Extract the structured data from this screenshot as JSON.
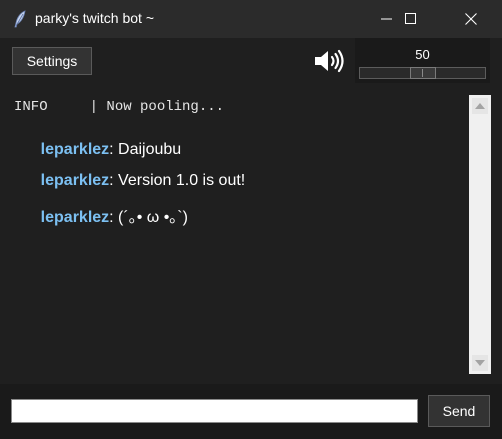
{
  "window": {
    "title": "parky's twitch bot ~"
  },
  "toolbar": {
    "settings_label": "Settings",
    "volume_icon": "speaker-icon",
    "volume": {
      "value_label": "50",
      "level": 0.5
    }
  },
  "chat": {
    "info_line": "INFO     | Now pooling...",
    "messages": [
      {
        "user": "leparklez",
        "sep": ": ",
        "text": "Daijoubu"
      },
      {
        "user": "leparklez",
        "sep": ": ",
        "text": "Version 1.0 is out!"
      },
      {
        "user": "leparklez",
        "sep": ": ",
        "text": "(´｡• ω •｡`)"
      }
    ]
  },
  "footer": {
    "input_value": "",
    "send_label": "Send"
  },
  "colors": {
    "background": "#1f1f1f",
    "username": "#7cc0f2",
    "text": "#ffffff"
  }
}
